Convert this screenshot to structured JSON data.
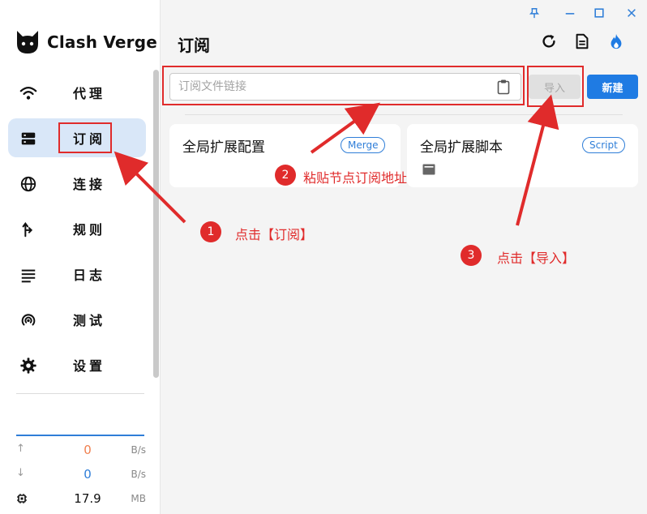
{
  "app": {
    "name": "Clash Verge"
  },
  "window_controls": [
    "pin-icon",
    "minimize-icon",
    "maximize-icon",
    "close-icon"
  ],
  "sidebar": {
    "items": [
      {
        "label": "代理",
        "icon": "wifi-icon"
      },
      {
        "label": "订阅",
        "icon": "server-icon",
        "active": true
      },
      {
        "label": "连接",
        "icon": "globe-icon"
      },
      {
        "label": "规则",
        "icon": "fork-icon"
      },
      {
        "label": "日志",
        "icon": "lines-icon"
      },
      {
        "label": "测试",
        "icon": "radar-icon"
      },
      {
        "label": "设置",
        "icon": "gear-icon"
      }
    ]
  },
  "traffic": {
    "upload": {
      "value": "0",
      "unit": "B/s"
    },
    "download": {
      "value": "0",
      "unit": "B/s"
    },
    "memory": {
      "value": "17.9",
      "unit": "MB"
    }
  },
  "header": {
    "title": "订阅"
  },
  "subscribe": {
    "placeholder": "订阅文件链接",
    "import_label": "导入",
    "new_label": "新建"
  },
  "cards": [
    {
      "title": "全局扩展配置",
      "chip": "Merge"
    },
    {
      "title": "全局扩展脚本",
      "chip": "Script"
    }
  ],
  "annotations": {
    "step1": {
      "num": "1",
      "text": "点击【订阅】"
    },
    "step2": {
      "num": "2",
      "text": "粘贴节点订阅地址"
    },
    "step3": {
      "num": "3",
      "text": "点击【导入】"
    }
  },
  "colors": {
    "accent": "#2f7ed8",
    "active_bg": "#d9e7f8",
    "annotation": "#e02b2b",
    "upload": "#f08050",
    "download": "#2f7ed8"
  }
}
